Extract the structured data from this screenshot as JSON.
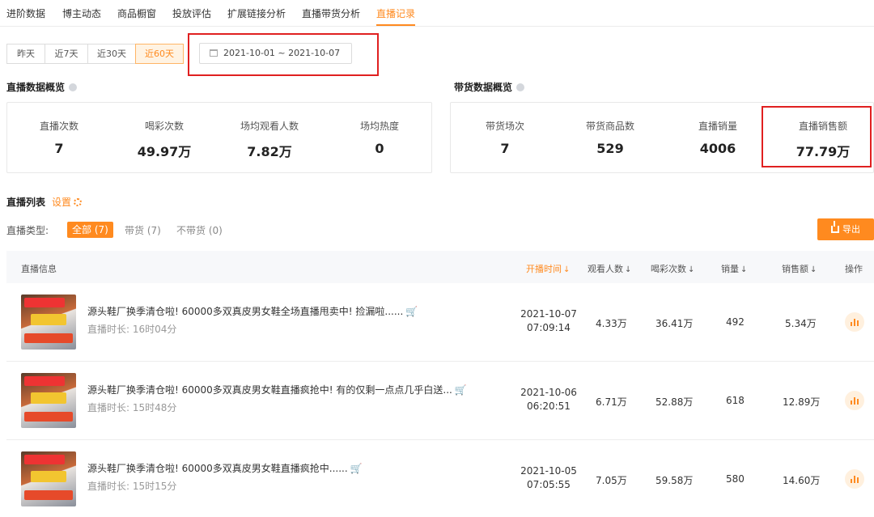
{
  "tabs": [
    {
      "label": "进阶数据"
    },
    {
      "label": "博主动态"
    },
    {
      "label": "商品橱窗"
    },
    {
      "label": "投放评估"
    },
    {
      "label": "扩展链接分析"
    },
    {
      "label": "直播带货分析"
    },
    {
      "label": "直播记录",
      "active": true
    }
  ],
  "range_buttons": [
    "昨天",
    "近7天",
    "近30天",
    "近60天"
  ],
  "range_active": "近60天",
  "date_range": "2021-10-01  ~  2021-10-07",
  "live_overview": {
    "title": "直播数据概览",
    "stats": [
      {
        "label": "直播次数",
        "value": "7"
      },
      {
        "label": "喝彩次数",
        "value": "49.97万"
      },
      {
        "label": "场均观看人数",
        "value": "7.82万"
      },
      {
        "label": "场均热度",
        "value": "0"
      }
    ]
  },
  "sales_overview": {
    "title": "带货数据概览",
    "stats": [
      {
        "label": "带货场次",
        "value": "7"
      },
      {
        "label": "带货商品数",
        "value": "529"
      },
      {
        "label": "直播销量",
        "value": "4006"
      },
      {
        "label": "直播销售额",
        "value": "77.79万"
      }
    ]
  },
  "list": {
    "title": "直播列表",
    "settings_label": "设置",
    "type_label": "直播类型:",
    "types": [
      "全部 (7)",
      "带货 (7)",
      "不带货 (0)"
    ],
    "export_label": "导出",
    "headers": {
      "info": "直播信息",
      "start_time": "开播时间",
      "viewers": "观看人数",
      "cheers": "喝彩次数",
      "sales": "销量",
      "revenue": "销售额",
      "action": "操作"
    },
    "rows": [
      {
        "title": "源头鞋厂换季清仓啦! 60000多双真皮男女鞋全场直播甩卖中! 捡漏啦......",
        "duration": "直播时长: 16时04分",
        "date": "2021-10-07",
        "time": "07:09:14",
        "viewers": "4.33万",
        "cheers": "36.41万",
        "sales": "492",
        "revenue": "5.34万"
      },
      {
        "title": "源头鞋厂换季清仓啦! 60000多双真皮男女鞋直播疯抢中! 有的仅剩一点点几乎白送...",
        "duration": "直播时长: 15时48分",
        "date": "2021-10-06",
        "time": "06:20:51",
        "viewers": "6.71万",
        "cheers": "52.88万",
        "sales": "618",
        "revenue": "12.89万"
      },
      {
        "title": "源头鞋厂换季清仓啦! 60000多双真皮男女鞋直播疯抢中......",
        "duration": "直播时长: 15时15分",
        "date": "2021-10-05",
        "time": "07:05:55",
        "viewers": "7.05万",
        "cheers": "59.58万",
        "sales": "580",
        "revenue": "14.60万"
      }
    ]
  },
  "colors": {
    "accent": "#ff8a1f",
    "highlight_box": "#e02020"
  }
}
